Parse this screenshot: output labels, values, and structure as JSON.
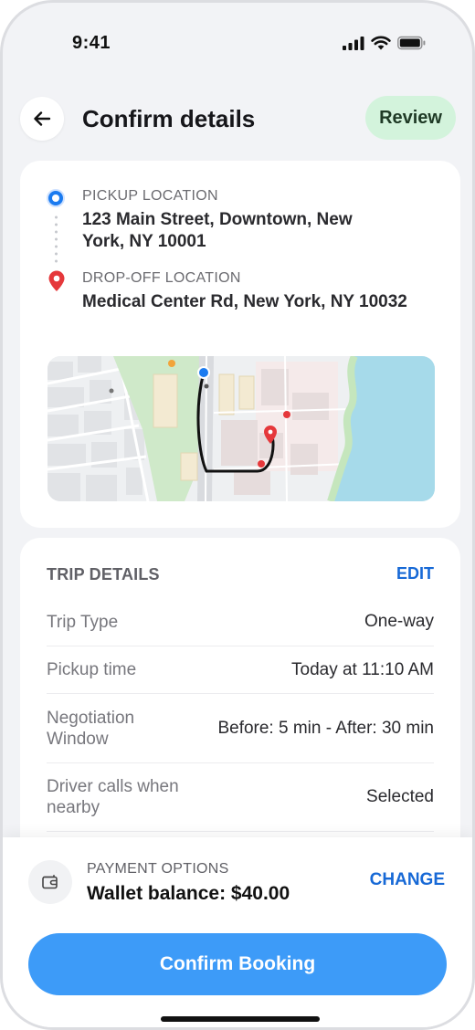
{
  "status_bar": {
    "time": "9:41",
    "icons": [
      "cellular-signal-icon",
      "wifi-icon",
      "battery-icon"
    ]
  },
  "header": {
    "back_icon": "arrow-left-icon",
    "title": "Confirm details",
    "badge": "Review",
    "badge_color": "#d3f3dc"
  },
  "route": {
    "pickup_label": "PICKUP LOCATION",
    "pickup_address": "123 Main Street, Downtown, New York, NY 10001",
    "dropoff_label": "DROP-OFF LOCATION",
    "dropoff_address": "Medical Center Rd, New York, NY 10032",
    "pickup_marker_color": "#1b7bf0",
    "dropoff_marker_color": "#e5383b"
  },
  "trip_details": {
    "heading": "TRIP DETAILS",
    "edit_label": "EDIT",
    "rows": [
      {
        "label": "Trip Type",
        "value": "One-way"
      },
      {
        "label": "Pickup time",
        "value": "Today at 11:10 AM"
      },
      {
        "label": "Negotiation Window",
        "value": "Before: 5 min - After: 30 min"
      },
      {
        "label": "Driver calls when nearby",
        "value": "Selected"
      }
    ]
  },
  "payment": {
    "icon": "wallet-icon",
    "label": "PAYMENT OPTIONS",
    "value": "Wallet balance: $40.00",
    "change_label": "CHANGE"
  },
  "actions": {
    "confirm_label": "Confirm Booking",
    "accent": "#3d9bf8",
    "link_color": "#1769d6"
  }
}
